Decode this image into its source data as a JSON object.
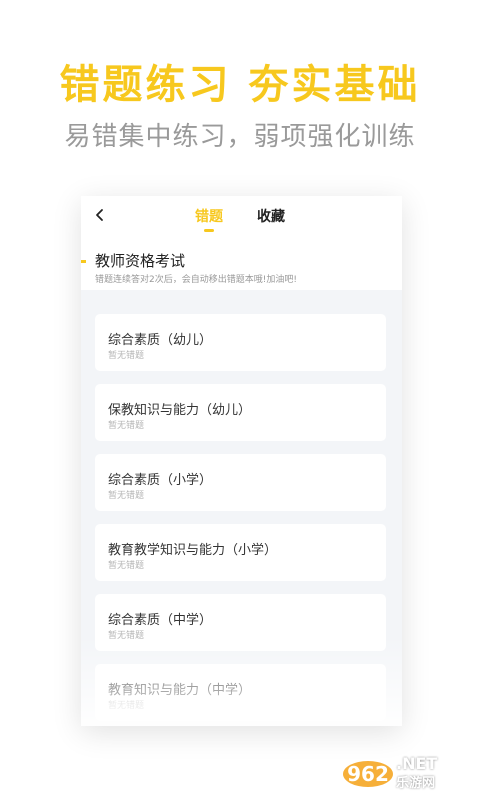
{
  "banner": {
    "title": "错题练习 夯实基础",
    "subtitle": "易错集中练习，弱项强化训练"
  },
  "topbar": {
    "back_icon": "chevron-left-icon",
    "tabs": [
      {
        "label": "错题",
        "active": true
      },
      {
        "label": "收藏",
        "active": false
      }
    ]
  },
  "section": {
    "title": "教师资格考试",
    "hint": "错题连续答对2次后，会自动移出错题本哦!加油吧!"
  },
  "items": [
    {
      "title": "综合素质（幼儿）",
      "status": "暂无错题"
    },
    {
      "title": "保教知识与能力（幼儿）",
      "status": "暂无错题"
    },
    {
      "title": "综合素质（小学）",
      "status": "暂无错题"
    },
    {
      "title": "教育教学知识与能力（小学）",
      "status": "暂无错题"
    },
    {
      "title": "综合素质（中学）",
      "status": "暂无错题"
    },
    {
      "title": "教育知识与能力（中学）",
      "status": "暂无错题"
    }
  ],
  "watermark": {
    "logo_text": "962",
    "net": ".NET",
    "site": "乐游网"
  },
  "colors": {
    "accent": "#f7c81e",
    "subtitle": "#9a9a9a",
    "list_bg": "#f3f5f8"
  }
}
